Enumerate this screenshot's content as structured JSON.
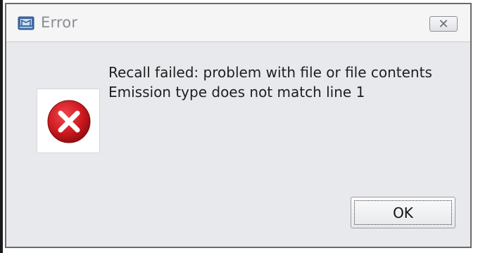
{
  "window": {
    "title": "Error",
    "title_icon": "app-window-icon",
    "close_label": "✕",
    "close_icon": "close-icon"
  },
  "message": {
    "icon": "error-icon",
    "line1": "Recall failed: problem with file or file contents",
    "line2": "Emission type does not match line 1"
  },
  "buttons": {
    "ok_label": "OK"
  },
  "colors": {
    "dialog_bg": "#e8e9ed",
    "titlebar_bg": "#f5f5f6",
    "error_red": "#c8161d",
    "text": "#1e1e1e"
  }
}
